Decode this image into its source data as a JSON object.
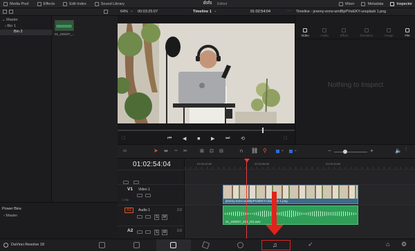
{
  "topbar": {
    "left_items": [
      {
        "label": "Media Pool",
        "icon": "media-pool-icon"
      },
      {
        "label": "Effects",
        "icon": "effects-icon"
      },
      {
        "label": "Edit Index",
        "icon": "edit-index-icon"
      },
      {
        "label": "Sound Library",
        "icon": "sound-library-icon"
      }
    ],
    "project_title": "dsfs",
    "project_state": "Edited",
    "right_items": [
      {
        "label": "Mixer",
        "icon": "mixer-icon"
      },
      {
        "label": "Metadata",
        "icon": "metadata-icon"
      },
      {
        "label": "Inspector",
        "icon": "inspector-icon"
      }
    ]
  },
  "viewer_bar": {
    "zoom": "64%",
    "source_timecode": "00:03:25:07",
    "timeline_name": "Timeline 1",
    "record_timecode": "01:02:54:04",
    "clip_filename": "Timeline - jeremy-enns-wmBlpPVwEKY-unsplash 1.png"
  },
  "media_pool": {
    "bins": [
      {
        "label": "Master"
      },
      {
        "label": "Bin 1"
      },
      {
        "label": "Bin 2"
      }
    ],
    "clip_name": "01_230207_...",
    "power_bins_label": "Power Bins",
    "power_bins_master": "Master"
  },
  "inspector": {
    "tabs": [
      "Video",
      "Audio",
      "Effect",
      "Transition",
      "Image",
      "File"
    ],
    "empty_text": "Nothing to Inspect"
  },
  "timeline": {
    "timecode": "01:02:54:04",
    "ruler_labels": [
      "01:02:42:00",
      "01:02:56:00",
      "01:03:10:00"
    ],
    "tracks": [
      {
        "id": "V1",
        "name": "Video 1"
      },
      {
        "id": "A1",
        "name": "Audio 1",
        "level": "2.0"
      },
      {
        "id": "A2",
        "name": "",
        "level": "2.0"
      }
    ],
    "video_clip_label": "jeremy-enns-wmBlpPVwEKY-unsplash 1.png",
    "audio_clip_label": "01_230207_224_r01.wav",
    "track_clip_label": "1 Clip",
    "mute_label": "M",
    "solo_label": "S"
  },
  "bottombar": {
    "app_name": "DaVinci Resolve 18",
    "pages": [
      "media",
      "cut",
      "edit",
      "fusion",
      "color",
      "fairlight",
      "deliver"
    ],
    "active_page": "edit",
    "highlighted_page": "fairlight"
  },
  "colors": {
    "accent": "#e25a2b",
    "playhead": "#e23a3a",
    "video_clip": "#3a6b8a",
    "audio_clip": "#2f9e57",
    "annotation": "#e0241a"
  }
}
